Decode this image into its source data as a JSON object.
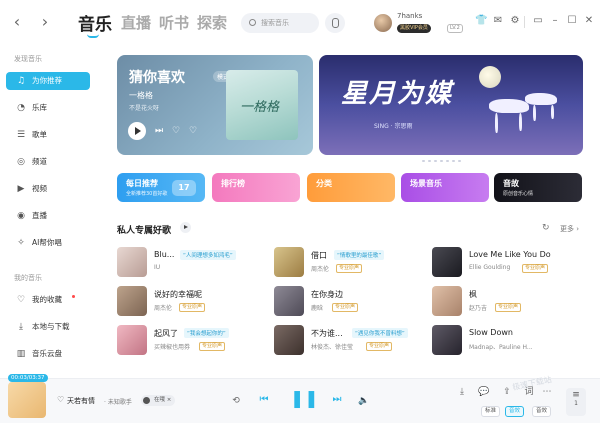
{
  "header": {
    "tabs": [
      {
        "label": "音乐",
        "active": true
      },
      {
        "label": "直播"
      },
      {
        "label": "听书"
      },
      {
        "label": "探索"
      }
    ],
    "search_placeholder": "搜索音乐",
    "username": "7hanks",
    "vip_label": "黑胶VIP会员",
    "level_label": "LV.2"
  },
  "sidebar": {
    "section1": "发现音乐",
    "items1": [
      {
        "label": "为你推荐",
        "icon": "recommend-icon",
        "active": true
      },
      {
        "label": "乐库",
        "icon": "library-icon"
      },
      {
        "label": "歌单",
        "icon": "playlist-icon"
      },
      {
        "label": "频道",
        "icon": "channel-icon"
      },
      {
        "label": "视频",
        "icon": "video-icon"
      },
      {
        "label": "直播",
        "icon": "live-icon"
      },
      {
        "label": "AI帮你唱",
        "icon": "ai-sing-icon"
      }
    ],
    "section2": "我的音乐",
    "items2": [
      {
        "label": "我的收藏",
        "icon": "heart-icon"
      },
      {
        "label": "本地与下载",
        "icon": "download-icon"
      },
      {
        "label": "音乐云盘",
        "icon": "cloud-icon"
      }
    ]
  },
  "banner_left": {
    "title": "猜你喜欢",
    "mode_label": "模式",
    "song": "一格格",
    "artist": "不是花火呀",
    "cover_text": "一格格"
  },
  "banner_right": {
    "title": "星月为媒",
    "subtitle": "SING · 宗思雨"
  },
  "quick_cards": [
    {
      "title": "每日推荐",
      "sub": "全新推荐30首好歌",
      "color": "#37a8ee",
      "badge": "17"
    },
    {
      "title": "排行榜",
      "sub": "",
      "color": "#f387c7"
    },
    {
      "title": "分类",
      "sub": "",
      "color": "#ffa84a"
    },
    {
      "title": "场景音乐",
      "sub": "",
      "color": "#b661e8"
    },
    {
      "title": "音故",
      "sub": "原创音乐心情",
      "color": "#1e1e26"
    }
  ],
  "section": {
    "title": "私人专属好歌",
    "more": "更多"
  },
  "songs": [
    {
      "name": "Blu...",
      "tag": "“人间理想多如鸿毛”",
      "artist": "IU",
      "vip": "",
      "cover": "#d9c6be"
    },
    {
      "name": "借口",
      "tag": "“情歌里的最佳歌”",
      "artist": "周杰伦",
      "vip": "专业原声",
      "cover": "#c9b27a"
    },
    {
      "name": "Love Me Like You Do",
      "tag": "",
      "artist": "Ellie Goulding",
      "vip": "专业原声",
      "cover": "#2f2f36"
    },
    {
      "name": "说好的幸福呢",
      "tag": "",
      "artist": "周杰伦",
      "vip": "专业原声",
      "cover": "#a68a72"
    },
    {
      "name": "在你身边",
      "tag": "",
      "artist": "鹿晗",
      "vip": "专业原声",
      "cover": "#6d6a74"
    },
    {
      "name": "枫",
      "tag": "",
      "artist": "赵乃吉",
      "vip": "专业原声",
      "cover": "#cba690"
    },
    {
      "name": "起风了",
      "tag": "“我会想起你的”",
      "artist": "买辣椒也用券",
      "vip": "专业原声",
      "cover": "#d99aa6"
    },
    {
      "name": "不为谁...",
      "tag": "“遇见你我不曾料想”",
      "artist": "林俊杰、徐佳莹",
      "vip": "专业原声",
      "cover": "#5c4e4a"
    },
    {
      "name": "Slow Down",
      "tag": "",
      "artist": "Madnap、Pauline H...",
      "vip": "",
      "cover": "#3e3a44"
    }
  ],
  "player": {
    "time": "00:03/03:37",
    "song": "天若有情",
    "artist": "· 未知歌手",
    "chip": "在哦",
    "pills": [
      {
        "label": "标准"
      },
      {
        "label": "音效"
      },
      {
        "label": "音效"
      }
    ],
    "playlist_count": "1",
    "watermark": "极速下载站"
  }
}
